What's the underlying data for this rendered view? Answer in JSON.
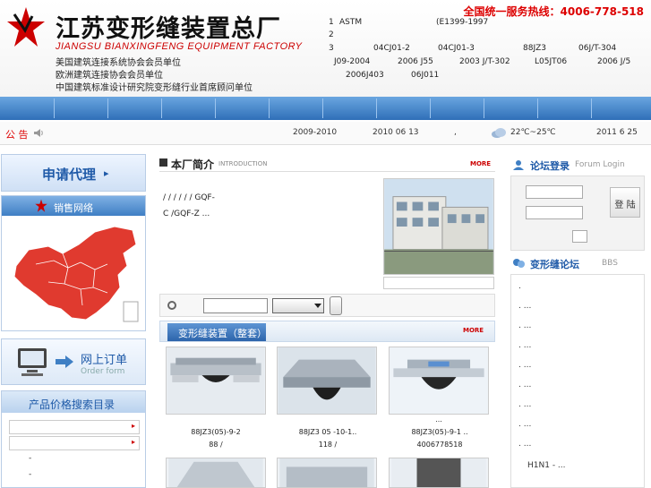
{
  "header": {
    "company_cn": "江苏变形缝装置总厂",
    "company_en": "JIANGSU BIANXINGFENG EQUIPMENT FACTORY",
    "hotline": "全国统一服务热线：4006-778-518",
    "members": [
      "美国建筑连接系统协会会员单位",
      "欧洲建筑连接协会会员单位",
      "中国建筑标准设计研究院变形缝行业首席顾问单位"
    ],
    "standards": {
      "r1_num": "1",
      "r1_a": "ASTM",
      "r1_b": "(E1399-1997",
      "r2_num": "2",
      "r3_num": "3",
      "r3_a": "04CJ01-2",
      "r3_b": "04CJ01-3",
      "r3_c": "88JZ3",
      "r3_d": "06J/T-304",
      "r4_a": "J09-2004",
      "r4_b": "2006 J55",
      "r4_c": "2003 J/T-302",
      "r4_d": "L05JT06",
      "r4_e": "2006 J/5",
      "r5_a": "2006J403",
      "r5_b": "06J011"
    }
  },
  "notice": {
    "label": "公 告",
    "items": [
      "2009-2010",
      "2010 06 13",
      ",",
      "22℃~25℃",
      "2011 6 25"
    ]
  },
  "left": {
    "agent": "申请代理",
    "agent_arrow": "▸",
    "sales_network": "销售网络",
    "order_cn": "网上订单",
    "order_en": "Order form",
    "price_title": "产品价格搜索目录",
    "price_marker": "▸",
    "price_links": [
      "-",
      "-"
    ]
  },
  "intro": {
    "title": "本厂简介",
    "subtitle": "INTRODUCTION",
    "more": "MORE",
    "line1": "/ / / /  / /  GQF-",
    "line2": "C /GQF-Z ..."
  },
  "products": {
    "tab": "变形缝装置（整套）",
    "more": "MORE",
    "ellipsis": "...",
    "items": [
      {
        "model": "88JZ3(05)-9-2",
        "price": "88 /"
      },
      {
        "model": "88JZ3 05 -10-1..",
        "price": "118 /"
      },
      {
        "model": "88JZ3(05)-9-1 ..",
        "price": "4006778518"
      }
    ]
  },
  "right": {
    "login_title": "论坛登录",
    "login_sub": "Forum Login",
    "login_btn": "登 陆",
    "forum_title": "变形缝论坛",
    "forum_sub": "BBS",
    "forum_items": [
      ".",
      ".   ...",
      ".   ...",
      ".   ...",
      ".   ...",
      ".   ...",
      ".   ...",
      ".   ...",
      ".   ...",
      "H1N1 -   ..."
    ]
  },
  "colors": {
    "brand_red": "#cc0000",
    "nav_blue": "#2f6fb8",
    "link_blue": "#1f5aa8"
  },
  "icons": [
    "star-logo-icon",
    "speaker-icon",
    "cloud-icon",
    "monitor-icon",
    "arrow-right-icon",
    "search-icon",
    "chevron-down-icon",
    "user-icon"
  ]
}
